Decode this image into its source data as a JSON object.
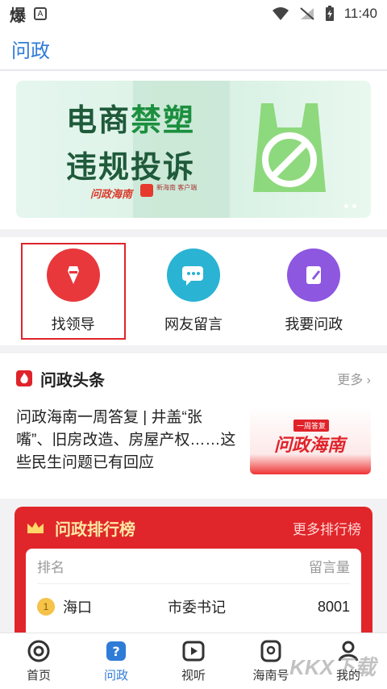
{
  "status": {
    "left_icon": "爆",
    "badge": "A",
    "time": "11:40"
  },
  "header": {
    "title": "问政"
  },
  "banner": {
    "line1_a": "电商",
    "line1_b": "禁塑",
    "line2": "违规投诉",
    "logo_text": "问政海南",
    "logo2_text": "新海南\n客户端"
  },
  "quick": [
    {
      "label": "找领导",
      "icon": "leader-icon",
      "color": "#e8383c"
    },
    {
      "label": "网友留言",
      "icon": "message-icon",
      "color": "#2ab3d3"
    },
    {
      "label": "我要问政",
      "icon": "question-icon",
      "color": "#8d57e0"
    }
  ],
  "news": {
    "title": "问政头条",
    "more": "更多",
    "headline": "问政海南一周答复 | 井盖“张嘴”、旧房改造、房屋产权……这些民生问题已有回应",
    "img_tag": "一周答复",
    "img_logo": "问政海南"
  },
  "rank": {
    "title": "问政排行榜",
    "more": "更多排行榜",
    "col1": "排名",
    "col2": "留言量",
    "rows": [
      {
        "medal": "1",
        "loc": "海口",
        "pos": "市委书记",
        "count": "8001"
      }
    ]
  },
  "tabs": [
    {
      "label": "首页",
      "icon": "home-swirl-icon"
    },
    {
      "label": "问政",
      "icon": "question-shield-icon"
    },
    {
      "label": "视听",
      "icon": "play-icon"
    },
    {
      "label": "海南号",
      "icon": "hainan-icon"
    },
    {
      "label": "我的",
      "icon": "profile-icon"
    }
  ],
  "watermark": "KKX下载"
}
